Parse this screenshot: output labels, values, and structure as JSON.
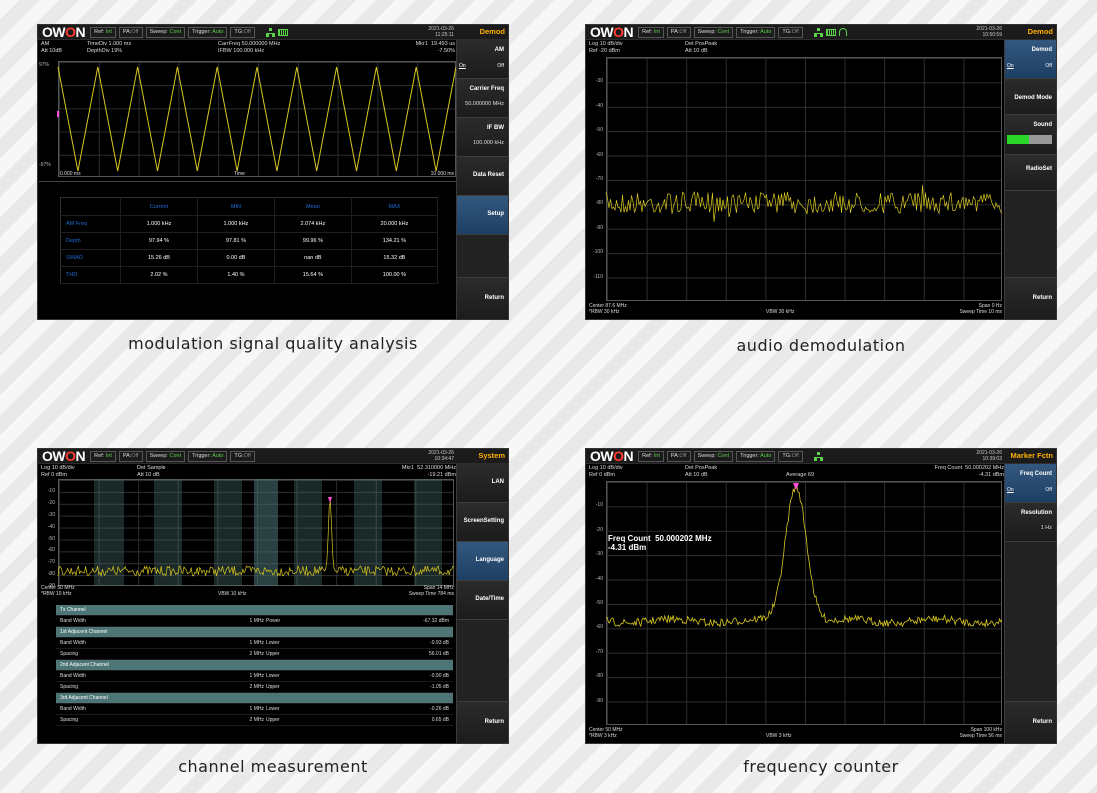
{
  "brand": {
    "o1": "OW",
    "o2": "O",
    "rest": "N"
  },
  "captions": [
    "modulation signal quality analysis",
    "audio demodulation",
    "channel measurement",
    "frequency counter"
  ],
  "colors": {
    "trace": "#d8c820",
    "accent": "#ffb000",
    "selected": "#2a4d75",
    "status_on": "#5ad24a",
    "table_header": "#1e6dd6",
    "channel_header": "#4d7576"
  },
  "statusbar": {
    "ref_label": "Ref:",
    "ref_value": "Int",
    "pa_label": "PA:",
    "pa_value": "Off",
    "sweep_label": "Sweep:",
    "sweep_value": "Cont",
    "trigger_label": "Trigger:",
    "trigger_value": "Auto",
    "tg_label": "TG:",
    "tg_value": "Off"
  },
  "icons": [
    "network-icon",
    "usb-icon",
    "headphone-icon"
  ],
  "p1": {
    "date": "2021-03-26",
    "time": "11:25:11",
    "menu": "Demod",
    "hdr1": "AM\nAtt 10dB",
    "hdr2": "TimeDiv 1.000 ms\nDepthDiv 19%",
    "hdr3": "CarrFreq 50.000000 MHz\nIFBW 100.000 kHz",
    "hdr4": "Mkr1  19.493 us\n-7.50%",
    "y_top": "97%",
    "y_bottom": "-97%",
    "x_left": "0.000 ms",
    "x_mid": "Time",
    "x_right": "10.000 ms",
    "softkeys": {
      "am": "AM",
      "on": "On",
      "off": "Off",
      "carrier": "Carrier Freq",
      "carrier_val": "50.000000 MHz",
      "ifbw": "IF BW",
      "ifbw_val": "100.000 kHz",
      "reset": "Data Reset",
      "setup": "Setup",
      "ret": "Return"
    },
    "table": {
      "head": [
        "Current",
        "MIN",
        "Mean",
        "MAX"
      ],
      "rows": [
        {
          "label": "AM Freq",
          "vals": [
            "1.000 kHz",
            "1.000 kHz",
            "2.074 kHz",
            "20.000 kHz"
          ]
        },
        {
          "label": "Depth",
          "vals": [
            "97.94 %",
            "97.81 %",
            "99.96 %",
            "134.21 %"
          ]
        },
        {
          "label": "SINAD",
          "vals": [
            "15.26 dB",
            "0.00 dB",
            "nan dB",
            "15.32 dB"
          ]
        },
        {
          "label": "THD",
          "vals": [
            "2.02 %",
            "1.40 %",
            "15.64 %",
            "100.00 %"
          ]
        }
      ]
    }
  },
  "p2": {
    "date": "2021-03-26",
    "time": "10:50:59",
    "menu": "Demod",
    "hdr1": "Log 10 dB/div\nRef -20 dBm",
    "hdr2": "Det PosPeak\nAtt 10 dB",
    "ylabels": [
      "-30",
      "-40",
      "-50",
      "-60",
      "-70",
      "-80",
      "-90",
      "-100",
      "-110"
    ],
    "foot_left": "Center 87.6 MHz\n*RBW 30 kHz",
    "foot_mid": "VBW 30 kHz",
    "foot_right": "Span 0 Hz\nSweep Time 10 ms",
    "softkeys": {
      "demod": "Demod",
      "on": "On",
      "off": "Off",
      "mode": "Demod Mode",
      "sound": "Sound",
      "radio": "RadioSet",
      "ret": "Return"
    },
    "sound_level": 0.48
  },
  "p3": {
    "date": "2021-03-26",
    "time": "10:34:47",
    "menu": "System",
    "hdr1": "Log 10 dB/div\nRef 0 dBm",
    "hdr2": "Det Sample\nAtt 10 dB",
    "hdr4": "Mkr1  52.310000 MHz\n-19.21 dBm",
    "ylabels": [
      "-10",
      "-20",
      "-30",
      "-40",
      "-50",
      "-60",
      "-70",
      "-80",
      "-90"
    ],
    "foot_left": "Center 50 MHz\n*RBW 10 kHz",
    "foot_mid": "VBW 10 kHz",
    "foot_right": "Span 14 MHz\nSweep Time 784 ms",
    "softkeys": {
      "lan": "LAN",
      "screen": "ScreenSetting",
      "language": "Language",
      "datetime": "Date/Time",
      "ret": "Return"
    },
    "rows": [
      {
        "type": "h",
        "c1": "Tx Channel"
      },
      {
        "c1": "Band Width",
        "c2": "1 MHz",
        "c3": "Power",
        "c4": "-67.32 dBm"
      },
      {
        "type": "h",
        "c1": "1st Adjacent Channel"
      },
      {
        "c1": "Band Width",
        "c2": "1 MHz",
        "c3": "Lower",
        "c4": "-0.93 dB"
      },
      {
        "c1": "Spacing",
        "c2": "2 MHz",
        "c3": "Upper",
        "c4": "56.01 dB"
      },
      {
        "type": "h",
        "c1": "2nd Adjacent Channel"
      },
      {
        "c1": "Band Width",
        "c2": "1 MHz",
        "c3": "Lower",
        "c4": "-0.90 dB"
      },
      {
        "c1": "Spacing",
        "c2": "2 MHz",
        "c3": "Upper",
        "c4": "-1.05 dB"
      },
      {
        "type": "h",
        "c1": "3rd Adjacent Channel"
      },
      {
        "c1": "Band Width",
        "c2": "1 MHz",
        "c3": "Lower",
        "c4": "-0.26 dB"
      },
      {
        "c1": "Spacing",
        "c2": "2 MHz",
        "c3": "Upper",
        "c4": "0.65 dB"
      }
    ]
  },
  "p4": {
    "date": "2021-03-26",
    "time": "10:39:03",
    "menu": "Marker Fctn",
    "hdr1": "Log 10 dB/div\nRef 0 dBm",
    "hdr2": "Det PosPeak\nAtt 10 dB",
    "hdr_mid": "Average 69",
    "hdr4": "Freq Count  50.000202 MHz\n-4.31 dBm",
    "ylabels": [
      "-10",
      "-20",
      "-30",
      "-40",
      "-50",
      "-60",
      "-70",
      "-80",
      "-90"
    ],
    "fc_label": "Freq Count  50.000202 MHz\n-4.31 dBm",
    "foot_left": "Center 50 MHz\n*RBW 3 kHz",
    "foot_mid": "VBW 3 kHz",
    "foot_right": "Span 100 kHz\nSweep Time 56 ms",
    "softkeys": {
      "fc": "Freq Count",
      "on": "On",
      "off": "Off",
      "res": "Resolution",
      "res_val": "1 Hz",
      "ret": "Return"
    }
  }
}
